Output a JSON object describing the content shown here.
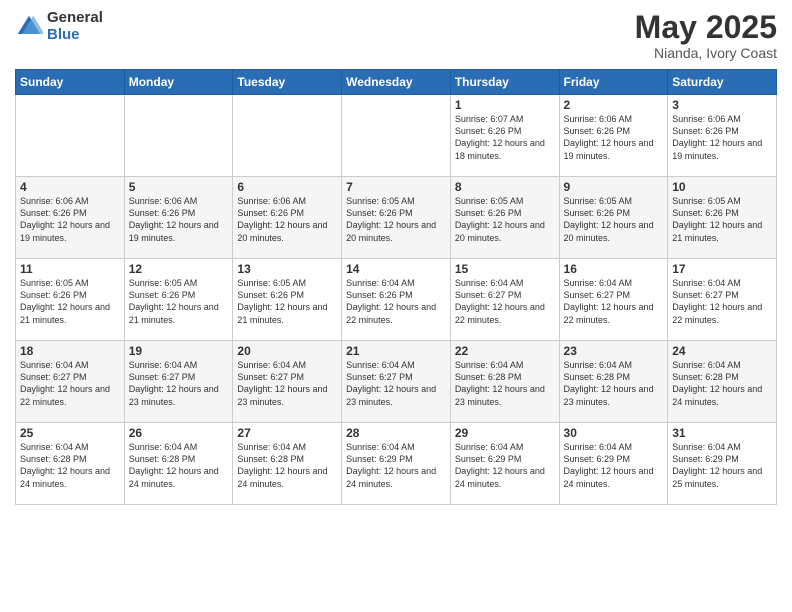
{
  "logo": {
    "general": "General",
    "blue": "Blue"
  },
  "title": "May 2025",
  "subtitle": "Nianda, Ivory Coast",
  "days_of_week": [
    "Sunday",
    "Monday",
    "Tuesday",
    "Wednesday",
    "Thursday",
    "Friday",
    "Saturday"
  ],
  "weeks": [
    [
      {
        "day": "",
        "info": ""
      },
      {
        "day": "",
        "info": ""
      },
      {
        "day": "",
        "info": ""
      },
      {
        "day": "",
        "info": ""
      },
      {
        "day": "1",
        "sunrise": "6:07 AM",
        "sunset": "6:26 PM",
        "daylight": "12 hours and 18 minutes."
      },
      {
        "day": "2",
        "sunrise": "6:06 AM",
        "sunset": "6:26 PM",
        "daylight": "12 hours and 19 minutes."
      },
      {
        "day": "3",
        "sunrise": "6:06 AM",
        "sunset": "6:26 PM",
        "daylight": "12 hours and 19 minutes."
      }
    ],
    [
      {
        "day": "4",
        "sunrise": "6:06 AM",
        "sunset": "6:26 PM",
        "daylight": "12 hours and 19 minutes."
      },
      {
        "day": "5",
        "sunrise": "6:06 AM",
        "sunset": "6:26 PM",
        "daylight": "12 hours and 19 minutes."
      },
      {
        "day": "6",
        "sunrise": "6:06 AM",
        "sunset": "6:26 PM",
        "daylight": "12 hours and 20 minutes."
      },
      {
        "day": "7",
        "sunrise": "6:05 AM",
        "sunset": "6:26 PM",
        "daylight": "12 hours and 20 minutes."
      },
      {
        "day": "8",
        "sunrise": "6:05 AM",
        "sunset": "6:26 PM",
        "daylight": "12 hours and 20 minutes."
      },
      {
        "day": "9",
        "sunrise": "6:05 AM",
        "sunset": "6:26 PM",
        "daylight": "12 hours and 20 minutes."
      },
      {
        "day": "10",
        "sunrise": "6:05 AM",
        "sunset": "6:26 PM",
        "daylight": "12 hours and 21 minutes."
      }
    ],
    [
      {
        "day": "11",
        "sunrise": "6:05 AM",
        "sunset": "6:26 PM",
        "daylight": "12 hours and 21 minutes."
      },
      {
        "day": "12",
        "sunrise": "6:05 AM",
        "sunset": "6:26 PM",
        "daylight": "12 hours and 21 minutes."
      },
      {
        "day": "13",
        "sunrise": "6:05 AM",
        "sunset": "6:26 PM",
        "daylight": "12 hours and 21 minutes."
      },
      {
        "day": "14",
        "sunrise": "6:04 AM",
        "sunset": "6:26 PM",
        "daylight": "12 hours and 22 minutes."
      },
      {
        "day": "15",
        "sunrise": "6:04 AM",
        "sunset": "6:27 PM",
        "daylight": "12 hours and 22 minutes."
      },
      {
        "day": "16",
        "sunrise": "6:04 AM",
        "sunset": "6:27 PM",
        "daylight": "12 hours and 22 minutes."
      },
      {
        "day": "17",
        "sunrise": "6:04 AM",
        "sunset": "6:27 PM",
        "daylight": "12 hours and 22 minutes."
      }
    ],
    [
      {
        "day": "18",
        "sunrise": "6:04 AM",
        "sunset": "6:27 PM",
        "daylight": "12 hours and 22 minutes."
      },
      {
        "day": "19",
        "sunrise": "6:04 AM",
        "sunset": "6:27 PM",
        "daylight": "12 hours and 23 minutes."
      },
      {
        "day": "20",
        "sunrise": "6:04 AM",
        "sunset": "6:27 PM",
        "daylight": "12 hours and 23 minutes."
      },
      {
        "day": "21",
        "sunrise": "6:04 AM",
        "sunset": "6:27 PM",
        "daylight": "12 hours and 23 minutes."
      },
      {
        "day": "22",
        "sunrise": "6:04 AM",
        "sunset": "6:28 PM",
        "daylight": "12 hours and 23 minutes."
      },
      {
        "day": "23",
        "sunrise": "6:04 AM",
        "sunset": "6:28 PM",
        "daylight": "12 hours and 23 minutes."
      },
      {
        "day": "24",
        "sunrise": "6:04 AM",
        "sunset": "6:28 PM",
        "daylight": "12 hours and 24 minutes."
      }
    ],
    [
      {
        "day": "25",
        "sunrise": "6:04 AM",
        "sunset": "6:28 PM",
        "daylight": "12 hours and 24 minutes."
      },
      {
        "day": "26",
        "sunrise": "6:04 AM",
        "sunset": "6:28 PM",
        "daylight": "12 hours and 24 minutes."
      },
      {
        "day": "27",
        "sunrise": "6:04 AM",
        "sunset": "6:28 PM",
        "daylight": "12 hours and 24 minutes."
      },
      {
        "day": "28",
        "sunrise": "6:04 AM",
        "sunset": "6:29 PM",
        "daylight": "12 hours and 24 minutes."
      },
      {
        "day": "29",
        "sunrise": "6:04 AM",
        "sunset": "6:29 PM",
        "daylight": "12 hours and 24 minutes."
      },
      {
        "day": "30",
        "sunrise": "6:04 AM",
        "sunset": "6:29 PM",
        "daylight": "12 hours and 24 minutes."
      },
      {
        "day": "31",
        "sunrise": "6:04 AM",
        "sunset": "6:29 PM",
        "daylight": "12 hours and 25 minutes."
      }
    ]
  ],
  "labels": {
    "sunrise": "Sunrise:",
    "sunset": "Sunset:",
    "daylight": "Daylight:"
  }
}
